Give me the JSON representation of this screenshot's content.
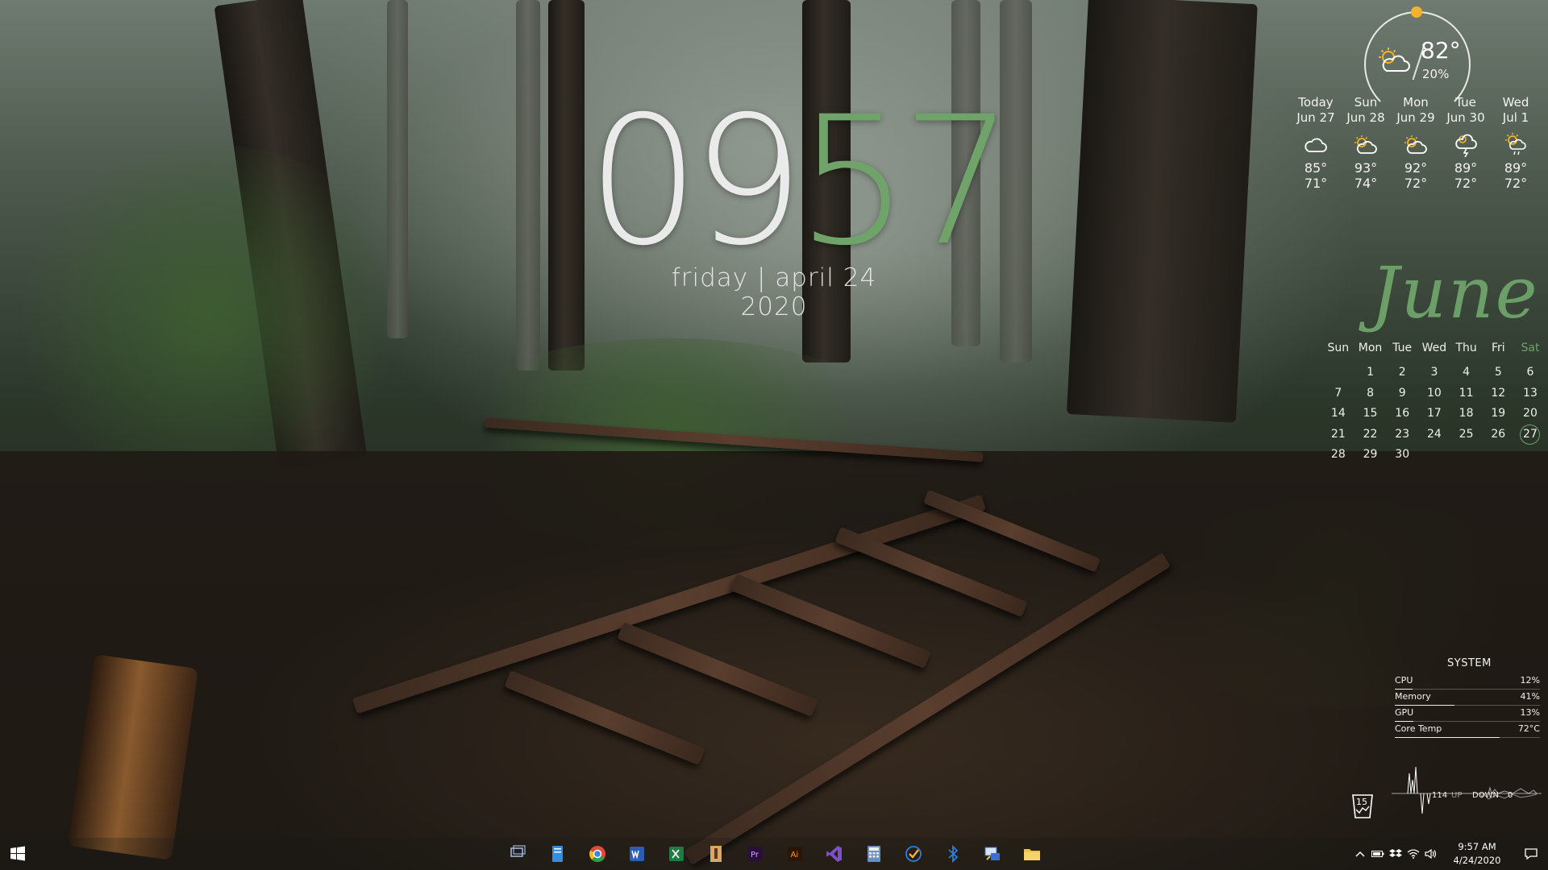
{
  "clock": {
    "hours": "09",
    "minutes": "57",
    "date_line": "friday | april 24 2020"
  },
  "weather": {
    "current": {
      "temp": "82°",
      "humidity": "20%",
      "icon": "partly-sunny-icon"
    },
    "forecast": [
      {
        "day": "Today",
        "date": "Jun 27",
        "icon": "cloud-icon",
        "high": "85°",
        "low": "71°"
      },
      {
        "day": "Sun",
        "date": "Jun 28",
        "icon": "partly-sunny-icon",
        "high": "93°",
        "low": "74°"
      },
      {
        "day": "Mon",
        "date": "Jun 29",
        "icon": "partly-sunny-icon",
        "high": "92°",
        "low": "72°"
      },
      {
        "day": "Tue",
        "date": "Jun 30",
        "icon": "thunderstorm-icon",
        "high": "89°",
        "low": "72°"
      },
      {
        "day": "Wed",
        "date": "Jul 1",
        "icon": "sun-rain-icon",
        "high": "89°",
        "low": "72°"
      }
    ]
  },
  "calendar": {
    "month": "June",
    "weekdays": [
      "Sun",
      "Mon",
      "Tue",
      "Wed",
      "Thu",
      "Fri",
      "Sat"
    ],
    "weeks": [
      [
        "",
        "1",
        "2",
        "3",
        "4",
        "5",
        "6"
      ],
      [
        "7",
        "8",
        "9",
        "10",
        "11",
        "12",
        "13"
      ],
      [
        "14",
        "15",
        "16",
        "17",
        "18",
        "19",
        "20"
      ],
      [
        "21",
        "22",
        "23",
        "24",
        "25",
        "26",
        "27"
      ],
      [
        "28",
        "29",
        "30",
        "",
        "",
        "",
        ""
      ]
    ],
    "today": "27"
  },
  "system": {
    "title": "SYSTEM",
    "rows": [
      {
        "label": "CPU",
        "value": "12%",
        "level": 0.12
      },
      {
        "label": "Memory",
        "value": "41%",
        "level": 0.41
      },
      {
        "label": "GPU",
        "value": "13%",
        "level": 0.13
      },
      {
        "label": "Core Temp",
        "value": "72°C",
        "level": 0.72
      }
    ],
    "network": {
      "up_value": "114",
      "up_label": "UP",
      "down_label": "DOWN",
      "down_value": "0"
    },
    "recycle_count": "15"
  },
  "taskbar": {
    "apps": [
      {
        "name": "task-view",
        "icon": "task-view-icon",
        "color": "#9fb4d8"
      },
      {
        "name": "files",
        "icon": "file-icon",
        "color": "#2f8fe6"
      },
      {
        "name": "chrome",
        "icon": "chrome-icon",
        "color": "#e04a3a"
      },
      {
        "name": "word",
        "icon": "word-icon",
        "color": "#2b5db5"
      },
      {
        "name": "excel",
        "icon": "excel-icon",
        "color": "#1f7a43"
      },
      {
        "name": "scrivener",
        "icon": "notebook-icon",
        "color": "#d8a86a"
      },
      {
        "name": "premiere",
        "icon": "premiere-icon",
        "color": "#2a0f3a"
      },
      {
        "name": "illustrator",
        "icon": "illustrator-icon",
        "color": "#2b1606"
      },
      {
        "name": "visual-studio",
        "icon": "visual-studio-icon",
        "color": "#7d4fc9"
      },
      {
        "name": "calculator",
        "icon": "calculator-icon",
        "color": "#6d8fbf"
      },
      {
        "name": "todo",
        "icon": "checkmark-icon",
        "color": "#2f7de0"
      },
      {
        "name": "bluetooth",
        "icon": "bluetooth-icon",
        "color": "#2f7de0"
      },
      {
        "name": "network-tool",
        "icon": "network-icon",
        "color": "#3d6fd0"
      },
      {
        "name": "file-explorer",
        "icon": "folder-icon",
        "color": "#f1c24a"
      }
    ],
    "tray_time": "9:57 AM",
    "tray_date": "4/24/2020"
  }
}
